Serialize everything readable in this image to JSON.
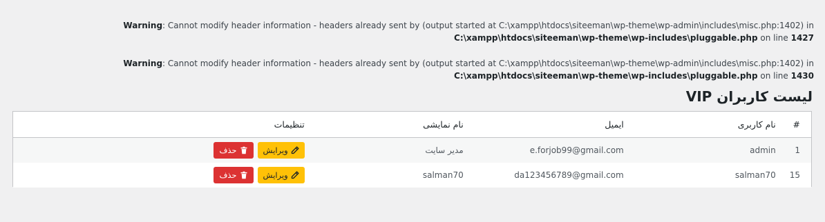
{
  "warnings": [
    {
      "label": "Warning",
      "message": ": Cannot modify header information - headers already sent by (output started at C:\\xampp\\htdocs\\siteeman\\wp-theme\\wp-admin\\includes\\misc.php:1402) in ",
      "file": "C:\\xampp\\htdocs\\siteeman\\wp-theme\\wp-includes\\pluggable.php",
      "on_line": " on line ",
      "line": "1427"
    },
    {
      "label": "Warning",
      "message": ": Cannot modify header information - headers already sent by (output started at C:\\xampp\\htdocs\\siteeman\\wp-theme\\wp-admin\\includes\\misc.php:1402) in ",
      "file": "C:\\xampp\\htdocs\\siteeman\\wp-theme\\wp-includes\\pluggable.php",
      "on_line": " on line ",
      "line": "1430"
    }
  ],
  "page_title": "لیست کاربران VIP",
  "table": {
    "headers": {
      "id": "#",
      "username": "نام کاربری",
      "email": "ایمیل",
      "display_name": "نام نمایشی",
      "settings": "تنظیمات"
    },
    "rows": [
      {
        "id": "1",
        "username": "admin",
        "email": "e.forjob99@gmail.com",
        "display_name": "مدیر سایت"
      },
      {
        "id": "15",
        "username": "salman70",
        "email": "da123456789@gmail.com",
        "display_name": "salman70"
      }
    ],
    "edit_label": "ویرایش",
    "delete_label": "حذف"
  },
  "colors": {
    "edit_button": "#ffc107",
    "delete_button": "#dc3232",
    "background": "#f0f0f1"
  },
  "icons": {
    "edit": "pencil-icon",
    "delete": "trash-icon"
  }
}
